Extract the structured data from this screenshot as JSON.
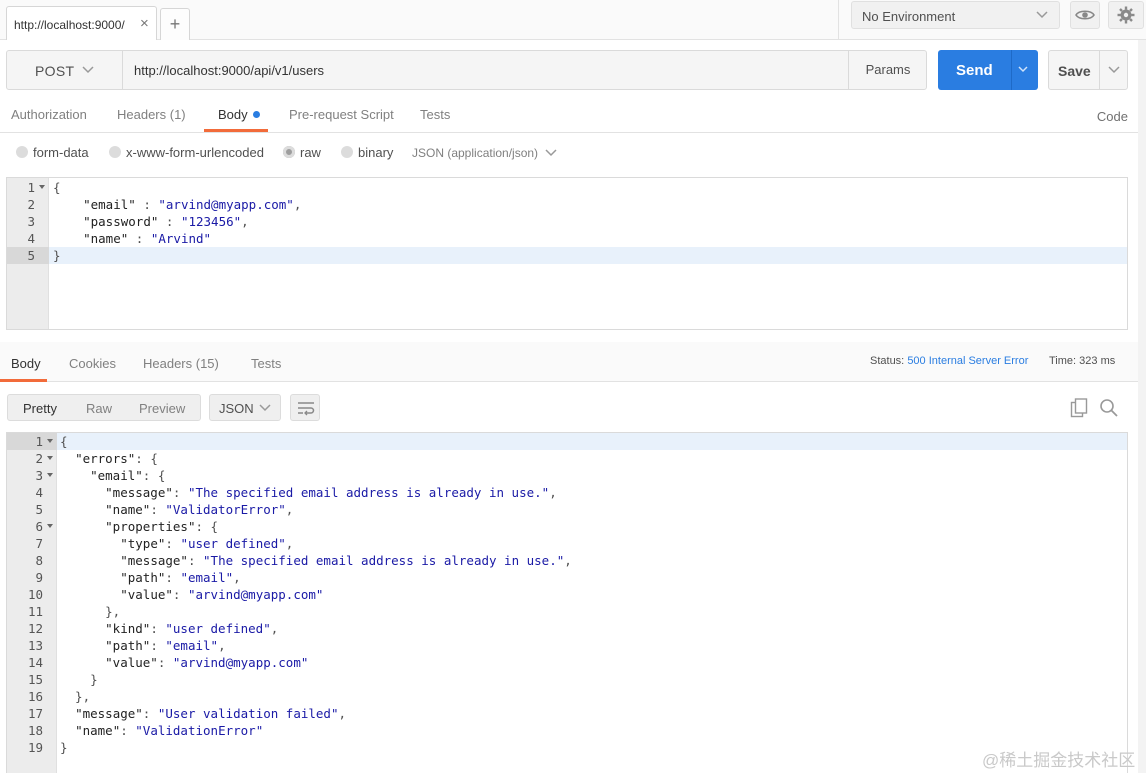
{
  "tabs": {
    "active_label": "http://localhost:9000/",
    "close_glyph": "×",
    "new_glyph": "+"
  },
  "environment": {
    "label": "No Environment"
  },
  "request": {
    "method": "POST",
    "url": "http://localhost:9000/api/v1/users",
    "params_label": "Params",
    "send_label": "Send",
    "save_label": "Save"
  },
  "request_tabs": [
    {
      "label": "Authorization"
    },
    {
      "label": "Headers (1)"
    },
    {
      "label": "Body"
    },
    {
      "label": "Pre-request Script"
    },
    {
      "label": "Tests"
    }
  ],
  "code_label": "Code",
  "body_types": {
    "form_data": "form-data",
    "urlencoded": "x-www-form-urlencoded",
    "raw": "raw",
    "binary": "binary",
    "content_type": "JSON (application/json)"
  },
  "request_body": [
    "{",
    "    \"email\" : \"arvind@myapp.com\",",
    "    \"password\" : \"123456\",",
    "    \"name\" : \"Arvind\"",
    "}"
  ],
  "response_tabs": [
    {
      "label": "Body"
    },
    {
      "label": "Cookies"
    },
    {
      "label": "Headers (15)"
    },
    {
      "label": "Tests"
    }
  ],
  "response_meta": {
    "status_label": "Status:",
    "status_value": "500 Internal Server Error",
    "time_label": "Time:",
    "time_value": "323 ms"
  },
  "view_modes": {
    "pretty": "Pretty",
    "raw": "Raw",
    "preview": "Preview"
  },
  "format": "JSON",
  "response_body": [
    "{",
    "  \"errors\": {",
    "    \"email\": {",
    "      \"message\": \"The specified email address is already in use.\",",
    "      \"name\": \"ValidatorError\",",
    "      \"properties\": {",
    "        \"type\": \"user defined\",",
    "        \"message\": \"The specified email address is already in use.\",",
    "        \"path\": \"email\",",
    "        \"value\": \"arvind@myapp.com\"",
    "      },",
    "      \"kind\": \"user defined\",",
    "      \"path\": \"email\",",
    "      \"value\": \"arvind@myapp.com\"",
    "    }",
    "  },",
    "  \"message\": \"User validation failed\",",
    "  \"name\": \"ValidationError\"",
    "}"
  ],
  "watermark": "@稀土掘金技术社区",
  "colors": {
    "accent": "#f26b3a",
    "send": "#2a7de1",
    "string": "#1a1aa6"
  }
}
